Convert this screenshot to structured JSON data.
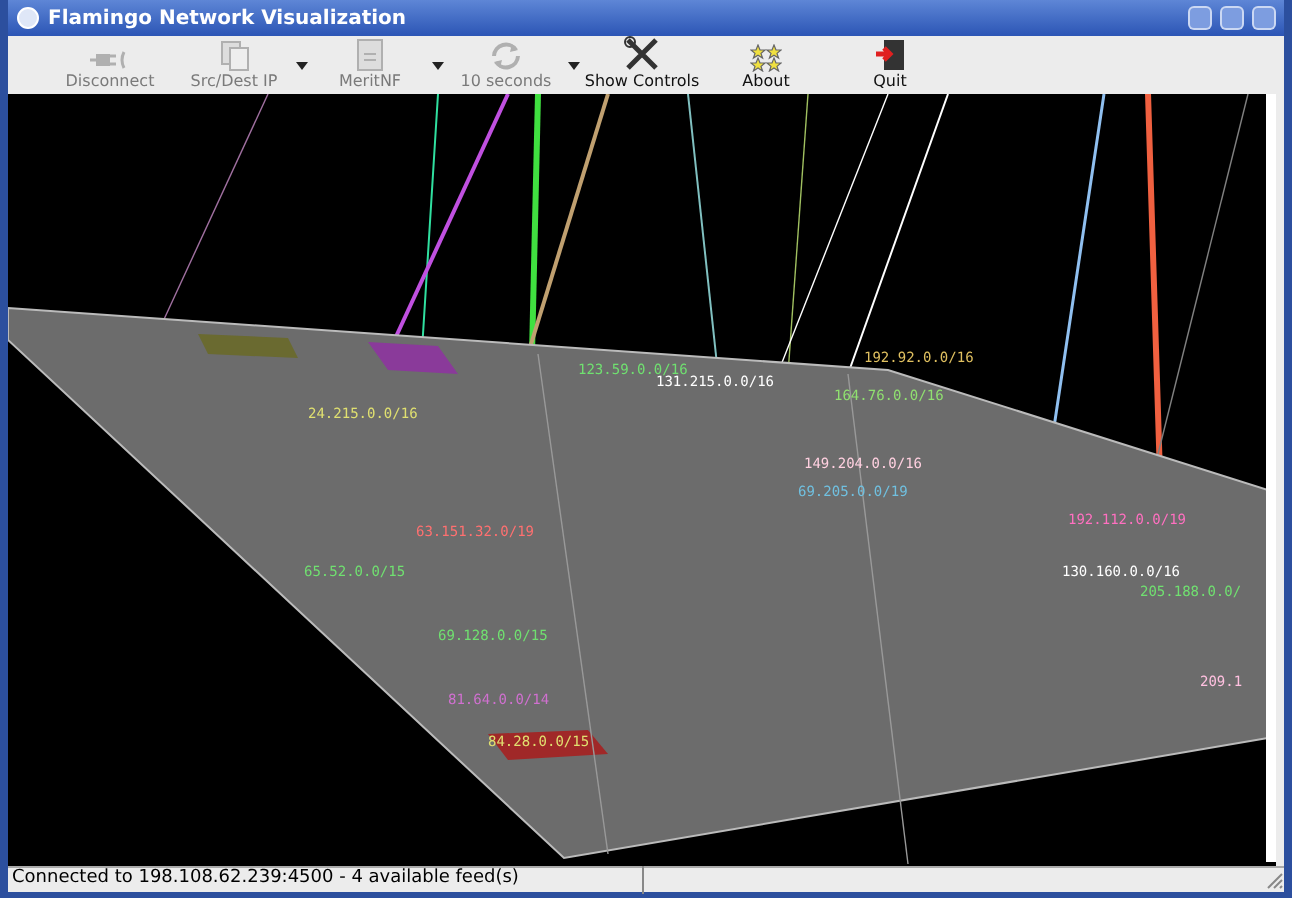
{
  "window": {
    "title": "Flamingo Network Visualization"
  },
  "toolbar": [
    {
      "kind": "disconnect",
      "label": "Disconnect",
      "disabled": true,
      "has_menu": false
    },
    {
      "kind": "srcdest",
      "label": "Src/Dest IP",
      "disabled": true,
      "has_menu": true
    },
    {
      "kind": "netflow",
      "label": "MeritNF",
      "disabled": true,
      "has_menu": true
    },
    {
      "kind": "refresh",
      "label": "10 seconds",
      "disabled": true,
      "has_menu": true
    },
    {
      "kind": "controls",
      "label": "Show Controls",
      "disabled": false,
      "has_menu": false
    },
    {
      "kind": "about",
      "label": "About",
      "disabled": false,
      "has_menu": false
    },
    {
      "kind": "quit",
      "label": "Quit",
      "disabled": false,
      "has_menu": false
    }
  ],
  "visualization": {
    "labels": [
      {
        "text": "192.92.0.0/16",
        "color": "#e0c060"
      },
      {
        "text": "123.59.0.0/16",
        "color": "#70e070"
      },
      {
        "text": "131.215.0.0/16",
        "color": "#ffffff"
      },
      {
        "text": "164.76.0.0/16",
        "color": "#90e070"
      },
      {
        "text": "24.215.0.0/16",
        "color": "#e0e070"
      },
      {
        "text": "149.204.0.0/16",
        "color": "#ffd0e0"
      },
      {
        "text": "69.205.0.0/19",
        "color": "#70c0e0"
      },
      {
        "text": "192.112.0.0/19",
        "color": "#ff70c0"
      },
      {
        "text": "63.151.32.0/19",
        "color": "#ff7070"
      },
      {
        "text": "65.52.0.0/15",
        "color": "#70e070"
      },
      {
        "text": "130.160.0.0/16",
        "color": "#ffffff"
      },
      {
        "text": "205.188.0.0/",
        "color": "#70e070"
      },
      {
        "text": "69.128.0.0/15",
        "color": "#70e070"
      },
      {
        "text": "209.1",
        "color": "#ffc0e0"
      },
      {
        "text": "81.64.0.0/14",
        "color": "#d070d0"
      },
      {
        "text": "84.28.0.0/15",
        "color": "#e0e070"
      }
    ]
  },
  "status_bar": {
    "text": "Connected to 198.108.62.239:4500 - 4 available feed(s)"
  }
}
